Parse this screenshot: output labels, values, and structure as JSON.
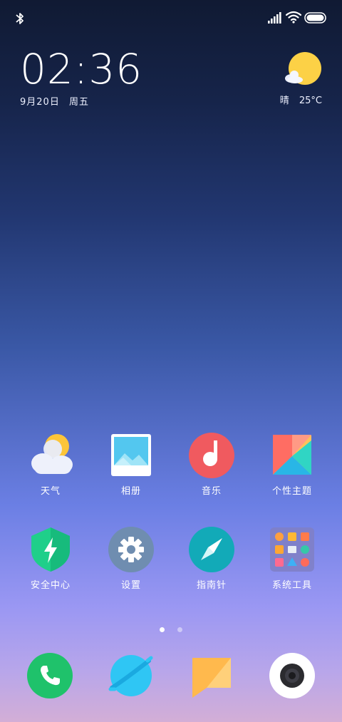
{
  "status_bar": {
    "icons": [
      "bluetooth-icon",
      "signal-icon",
      "wifi-icon",
      "battery-icon"
    ]
  },
  "clock": {
    "time": "02:36",
    "date": "9月20日",
    "weekday": "周五"
  },
  "weather_widget": {
    "condition": "晴",
    "temperature": "25°C",
    "icon": "sun-cloud-icon"
  },
  "apps": [
    {
      "label": "天气",
      "icon": "weather-icon"
    },
    {
      "label": "相册",
      "icon": "gallery-icon"
    },
    {
      "label": "音乐",
      "icon": "music-icon"
    },
    {
      "label": "个性主题",
      "icon": "themes-icon"
    },
    {
      "label": "安全中心",
      "icon": "security-icon"
    },
    {
      "label": "设置",
      "icon": "settings-icon"
    },
    {
      "label": "指南针",
      "icon": "compass-icon"
    },
    {
      "label": "系统工具",
      "icon": "folder-icon"
    }
  ],
  "pages": {
    "count": 2,
    "current": 1
  },
  "dock": [
    {
      "icon": "phone-icon"
    },
    {
      "icon": "browser-icon"
    },
    {
      "icon": "messages-icon"
    },
    {
      "icon": "camera-icon"
    }
  ],
  "colors": {
    "phone": "#1fc26b",
    "browser": "#2fc6f4",
    "messages": "#ffb94d",
    "music": "#f05a5f",
    "security": "#1fcf8a",
    "settings": "#6f8db0",
    "compass": "#12aab8"
  }
}
